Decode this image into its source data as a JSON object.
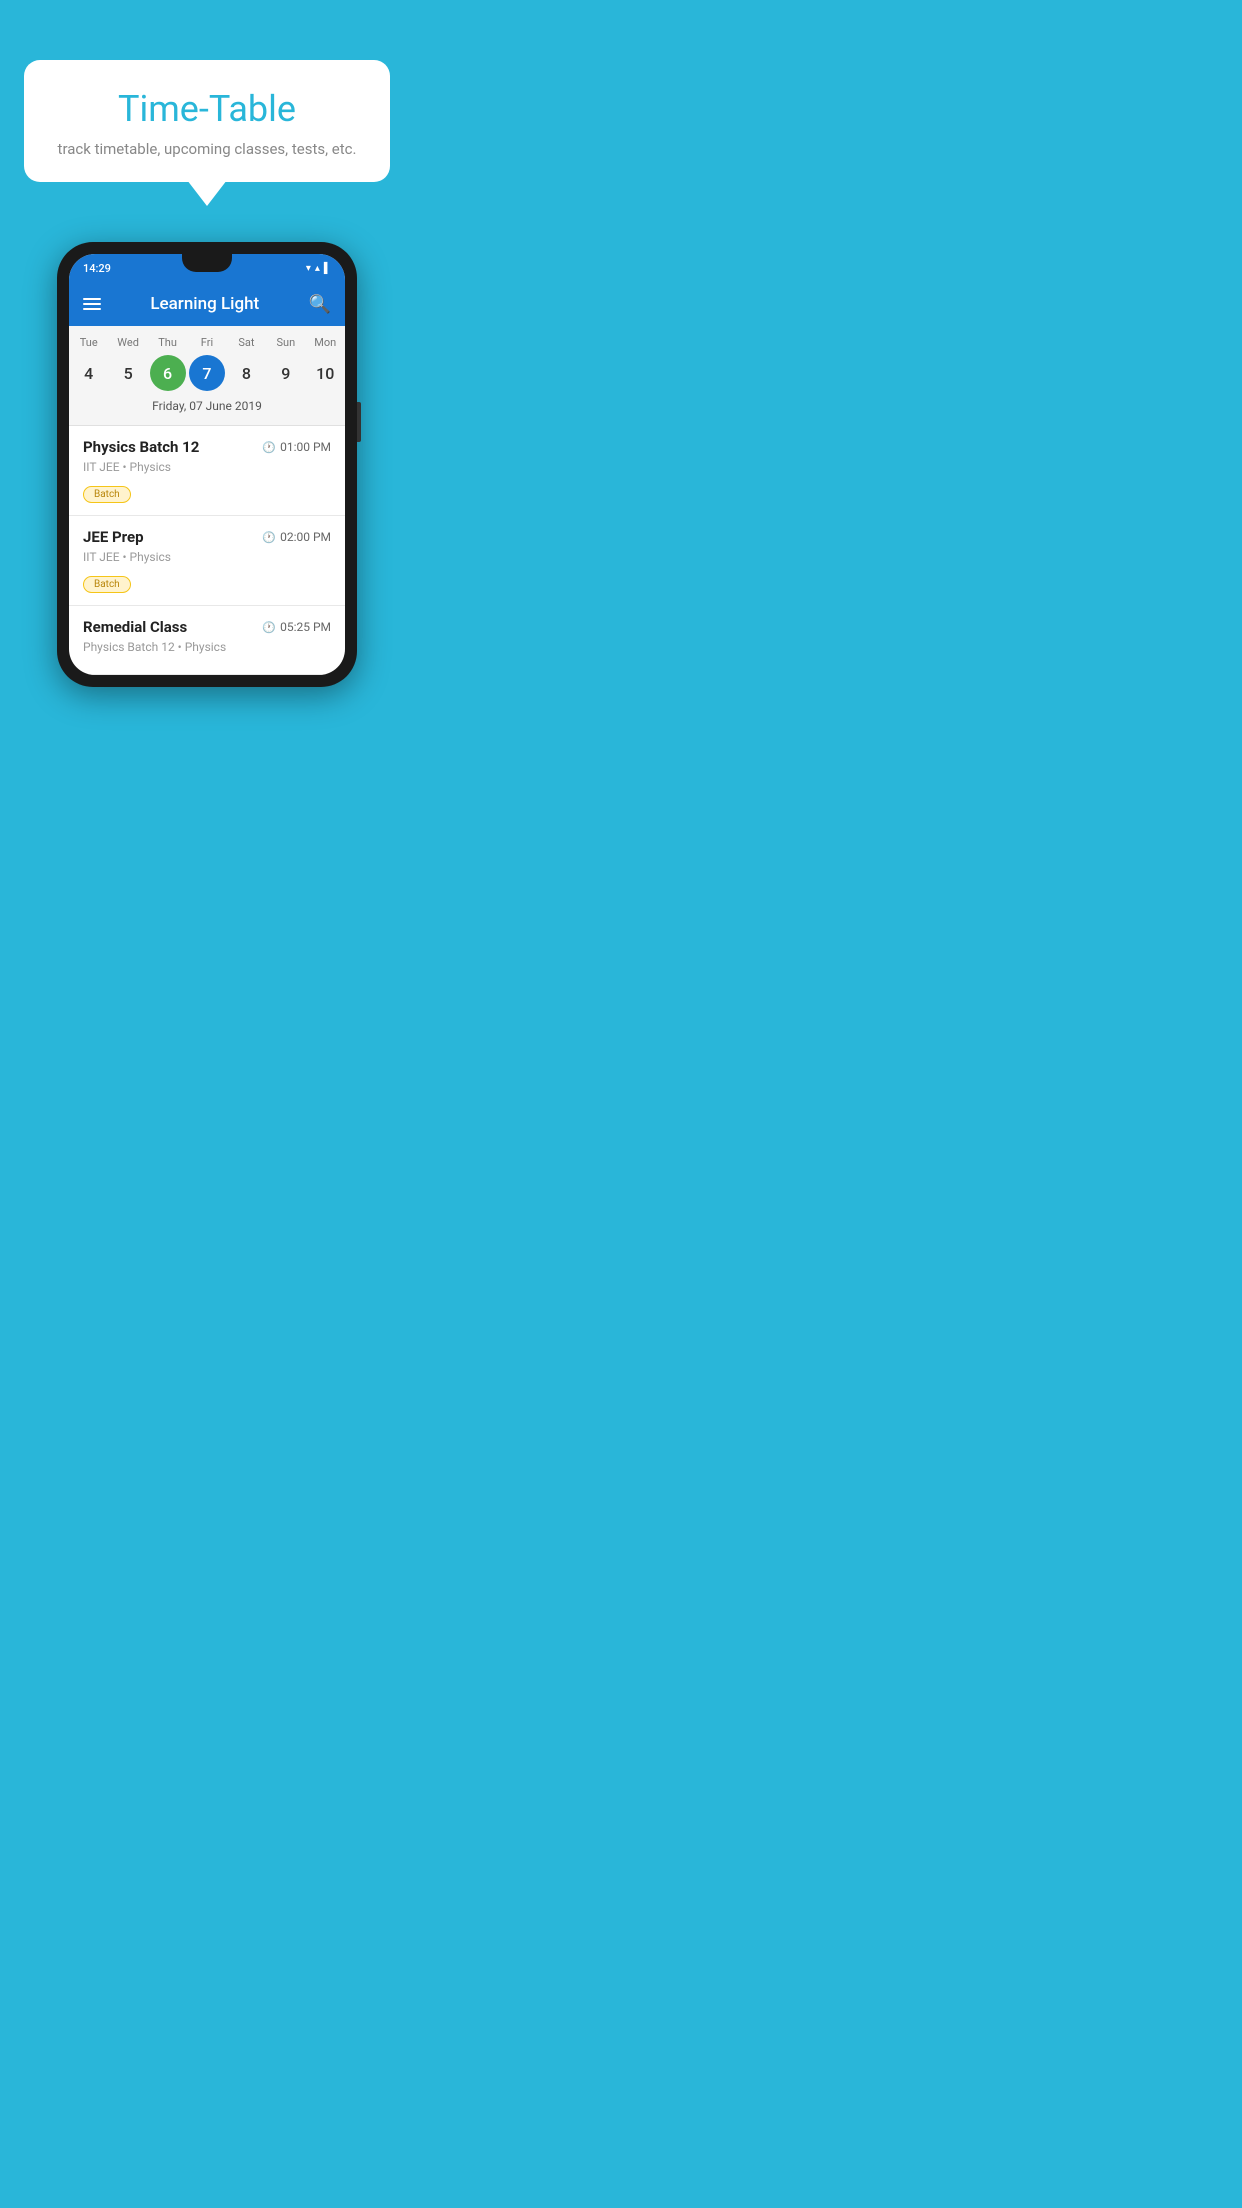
{
  "background": {
    "color": "#29B6D9"
  },
  "speech_bubble": {
    "title": "Time-Table",
    "subtitle": "track timetable, upcoming classes, tests, etc."
  },
  "phone": {
    "status_bar": {
      "time": "14:29",
      "wifi_icon": "▼",
      "signal_icon": "▲",
      "battery_icon": "▌"
    },
    "app_bar": {
      "title": "Learning Light",
      "menu_icon": "menu",
      "search_icon": "search"
    },
    "calendar": {
      "days": [
        "Tue",
        "Wed",
        "Thu",
        "Fri",
        "Sat",
        "Sun",
        "Mon"
      ],
      "dates": [
        "4",
        "5",
        "6",
        "7",
        "8",
        "9",
        "10"
      ],
      "today_index": 2,
      "selected_index": 3,
      "selected_label": "Friday, 07 June 2019"
    },
    "schedule": [
      {
        "title": "Physics Batch 12",
        "time": "01:00 PM",
        "subtitle": "IIT JEE • Physics",
        "badge": "Batch"
      },
      {
        "title": "JEE Prep",
        "time": "02:00 PM",
        "subtitle": "IIT JEE • Physics",
        "badge": "Batch"
      },
      {
        "title": "Remedial Class",
        "time": "05:25 PM",
        "subtitle": "Physics Batch 12 • Physics",
        "badge": ""
      }
    ]
  }
}
